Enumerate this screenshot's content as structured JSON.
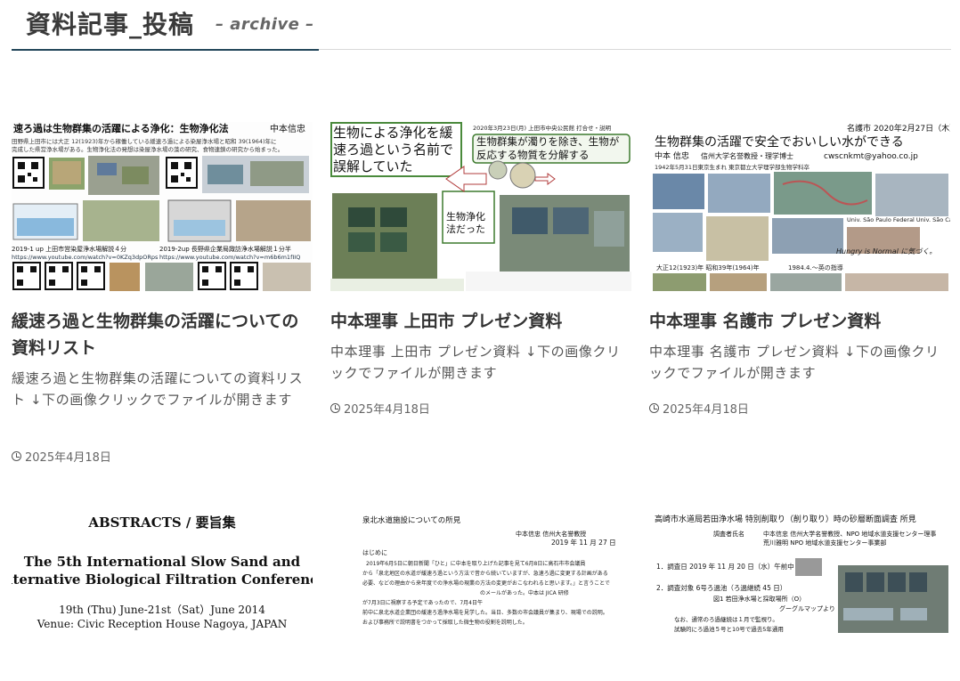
{
  "header": {
    "title": "資料記事_投稿",
    "subtitle": "– archive –"
  },
  "cards": [
    {
      "title": "緩速ろ過と生物群集の活躍についての資料リスト",
      "excerpt": "緩速ろ過と生物群集の活躍についての資料リスト ↓下の画像クリックでファイルが開きます",
      "date": "2025年4月18日",
      "thumb": {
        "heading": "速ろ過は生物群集の活躍による浄化：生物浄化法",
        "author": "中本信忠",
        "line1": "田野県上田市には大正 12(1923)年から稼働している緩速ろ過による染屋浄水場と昭和 39(1964)年に",
        "line2": "完成した県営浄水場がある。生物浄化法の発想は染屋浄水場の藻の研究、食物連鎖の研究から始まった。",
        "cap1": "2019-1 up 上田市営染屋浄水場解説４分",
        "url1": "https://www.youtube.com/watch?v=0KZq3dpORps",
        "cap2": "2019-2up 長野県企業局諏訪浄水場解説１分半",
        "url2": "https://www.youtube.com/watch?v=m6b6m1fIIQ"
      }
    },
    {
      "title": "中本理事 上田市 プレゼン資料",
      "excerpt": "中本理事 上田市 プレゼン資料 ↓下の画像クリックでファイルが開きます",
      "date": "2025年4月18日",
      "thumb": {
        "box": "生物による浄化を緩速ろ過という名前で誤解していた",
        "date_line": "2020年3月23日(月) 上田市中央公民館  打合せ・説明",
        "bubble": "生物群集が濁りを除き、生物が反応する物質を分解する",
        "label": "生物浄化法だった"
      }
    },
    {
      "title": "中本理事 名護市 プレゼン資料",
      "excerpt": "中本理事 名護市 プレゼン資料 ↓下の画像クリックでファイルが開きます",
      "date": "2025年4月18日",
      "thumb": {
        "place": "名護市",
        "date": "2020年2月27日（木）",
        "heading": "生物群集の活躍で安全でおいしい水ができる",
        "author": "中本 信忠",
        "affil": "信州大学名誉教授・理学博士",
        "email": "cwscnkmt@yahoo.co.jp",
        "birth": "1942年5月31日東京生まれ  東京都立大学理学部生物学科卒",
        "uni": "Univ. São Paulo Federal Univ. São Carlos",
        "hungry": "Hungry is Normal に気づく。",
        "era": "大正12(1923)年  昭和39年(1964)年",
        "trip": "1984.4.〜英の指導"
      }
    },
    {
      "thumb": {
        "title": "ABSTRACTS / 要旨集",
        "conf1": "The 5th International Slow Sand and",
        "conf2": "Alternative Biological Filtration Conference",
        "dates": "19th (Thu) June-21st（Sat）June 2014",
        "venue": "Venue: Civic Reception House Nagoya, JAPAN"
      }
    },
    {
      "thumb": {
        "heading": "泉北水道施設についての所見",
        "author": "中本信忠  信州大名誉教授",
        "date": "2019 年 11 月 27 日",
        "intro": "はじめに",
        "p1": "2019年6月5日に朝日新聞「ひと」に中本を取り上げた記事を見て6月8日に高石市市会議員",
        "p2": "から「泉北地区の水道が緩速ろ過という方法で昔から続いていますが、急速ろ過に変更する計画がある",
        "p3": "必要、などの理由から来年度での浄水場の現業の方法の変更がおこなわれると思います。」と言うことで",
        "p4": "のメールがあった。中本は JICA 研修",
        "p5": "が7月3日に視察する予定であったので、7月4日午",
        "p6": "前中に泉北水道企業団の緩速ろ過浄水場を見学した。当日、多数の市会議員が集まり、現場での説明。",
        "p7": "および事務所で説明書をつかって採取した微生物の役割を説明した。"
      }
    },
    {
      "thumb": {
        "heading": "高崎市水道局若田浄水場  特別削取り（削り取り）時の砂層断面調査  所見",
        "role": "調査者氏名",
        "p1": "中本信忠  信州大学名誉教授、NPO 地域水道支援センター理事",
        "p2": "荒川雅明  NPO 地域水道支援センター事業部",
        "i1": "1．調査日    2019 年 11 月 20 日（水）午前中",
        "i2": "2．調査対象  6号ろ過池（ろ過継続 45 日）",
        "i3": "図1  若田浄水場と採取場所（O）",
        "i4": "グーグルマップより",
        "i5": "なお、通常のろ過継続は１月で監視り。",
        "i6": "試験的にろ過池５号と10号で過去5年通用"
      }
    }
  ]
}
